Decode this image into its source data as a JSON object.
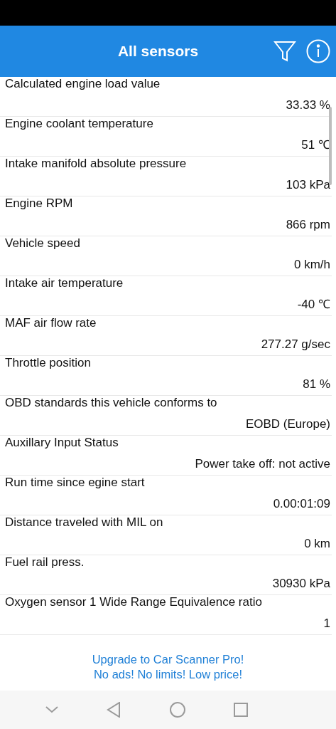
{
  "app_bar": {
    "title": "All sensors"
  },
  "sensors": [
    {
      "name": "Calculated engine load value",
      "value": "33.33 %"
    },
    {
      "name": "Engine coolant temperature",
      "value": "51 ℃"
    },
    {
      "name": "Intake manifold absolute pressure",
      "value": "103 kPa"
    },
    {
      "name": "Engine RPM",
      "value": "866 rpm"
    },
    {
      "name": "Vehicle speed",
      "value": "0 km/h"
    },
    {
      "name": "Intake air temperature",
      "value": "-40 ℃"
    },
    {
      "name": "MAF air flow rate",
      "value": "277.27 g/sec"
    },
    {
      "name": "Throttle position",
      "value": "81 %"
    },
    {
      "name": "OBD standards this vehicle conforms to",
      "value": "EOBD (Europe)"
    },
    {
      "name": "Auxillary Input Status",
      "value": "Power take off: not active"
    },
    {
      "name": "Run time since egine start",
      "value": "0.00:01:09"
    },
    {
      "name": "Distance traveled with MIL on",
      "value": "0 km"
    },
    {
      "name": "Fuel rail press.",
      "value": "30930 kPa"
    },
    {
      "name": "Oxygen sensor 1 Wide Range Equivalence ratio",
      "value": "1"
    }
  ],
  "promo": {
    "lines": [
      "Upgrade to Car Scanner Pro!",
      "No ads! No limits! Low price!"
    ]
  }
}
